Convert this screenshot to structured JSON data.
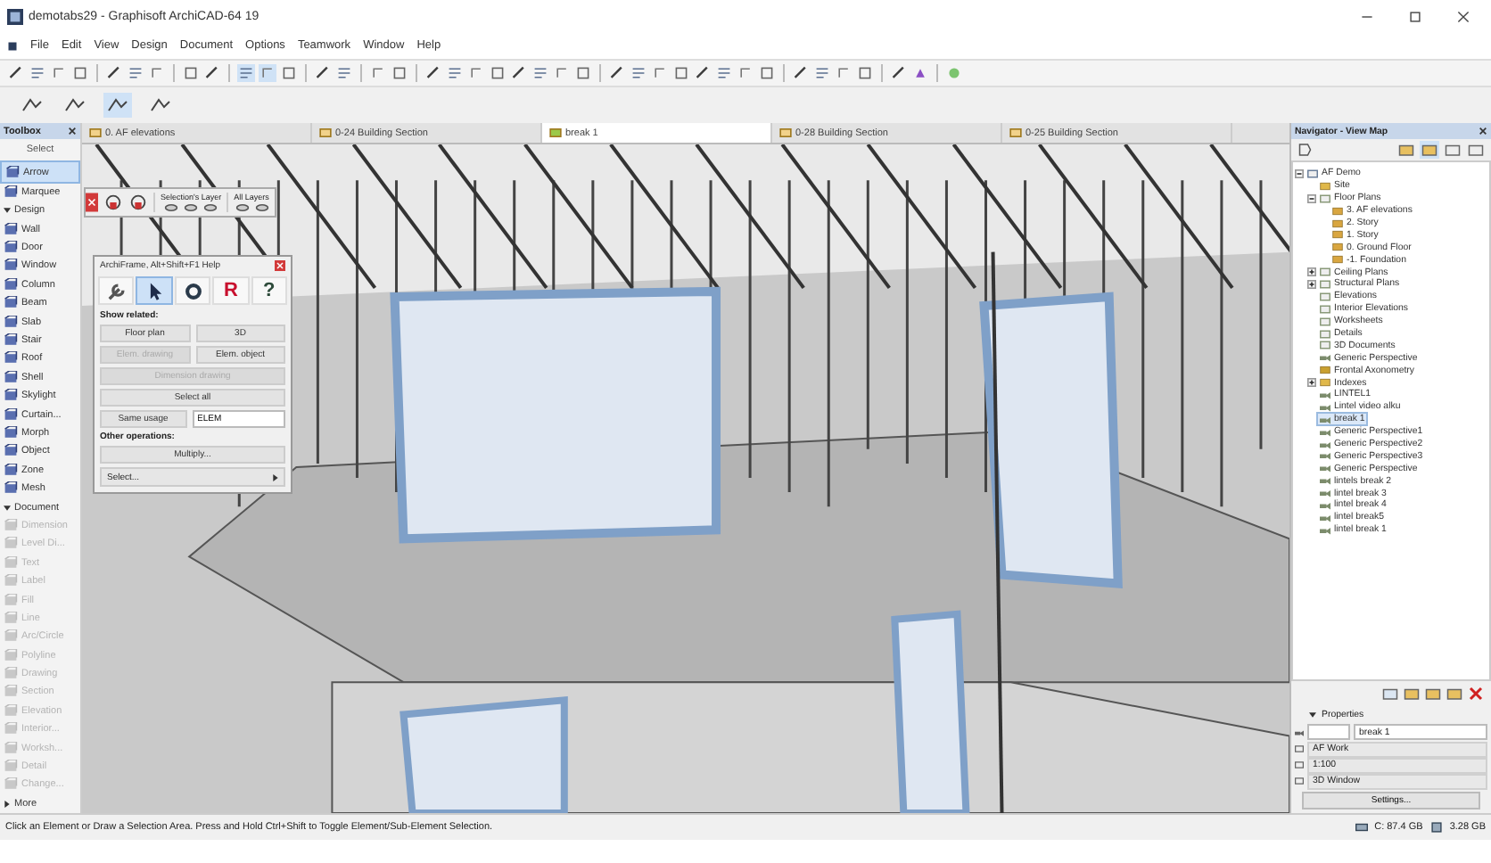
{
  "window": {
    "title": "demotabs29 - Graphisoft ArchiCAD-64 19"
  },
  "menu": [
    "File",
    "Edit",
    "View",
    "Design",
    "Document",
    "Options",
    "Teamwork",
    "Window",
    "Help"
  ],
  "tabs": [
    {
      "label": "0. AF elevations",
      "selected": false
    },
    {
      "label": "0-24 Building Section",
      "selected": false
    },
    {
      "label": "break 1",
      "selected": true
    },
    {
      "label": "0-28 Building Section",
      "selected": false
    },
    {
      "label": "0-25 Building Section",
      "selected": false
    }
  ],
  "toolbox": {
    "title": "Toolbox",
    "items": [
      {
        "kind": "header",
        "label": "Select"
      },
      {
        "kind": "tool",
        "label": "Arrow",
        "selected": true,
        "disabled": false
      },
      {
        "kind": "tool",
        "label": "Marquee",
        "selected": false,
        "disabled": false
      },
      {
        "kind": "section",
        "label": "Design",
        "expanded": true
      },
      {
        "kind": "tool",
        "label": "Wall",
        "selected": false,
        "disabled": false
      },
      {
        "kind": "tool",
        "label": "Door",
        "selected": false,
        "disabled": false
      },
      {
        "kind": "tool",
        "label": "Window",
        "selected": false,
        "disabled": false
      },
      {
        "kind": "tool",
        "label": "Column",
        "selected": false,
        "disabled": false
      },
      {
        "kind": "tool",
        "label": "Beam",
        "selected": false,
        "disabled": false
      },
      {
        "kind": "tool",
        "label": "Slab",
        "selected": false,
        "disabled": false
      },
      {
        "kind": "tool",
        "label": "Stair",
        "selected": false,
        "disabled": false
      },
      {
        "kind": "tool",
        "label": "Roof",
        "selected": false,
        "disabled": false
      },
      {
        "kind": "tool",
        "label": "Shell",
        "selected": false,
        "disabled": false
      },
      {
        "kind": "tool",
        "label": "Skylight",
        "selected": false,
        "disabled": false
      },
      {
        "kind": "tool",
        "label": "Curtain...",
        "selected": false,
        "disabled": false
      },
      {
        "kind": "tool",
        "label": "Morph",
        "selected": false,
        "disabled": false
      },
      {
        "kind": "tool",
        "label": "Object",
        "selected": false,
        "disabled": false
      },
      {
        "kind": "tool",
        "label": "Zone",
        "selected": false,
        "disabled": false
      },
      {
        "kind": "tool",
        "label": "Mesh",
        "selected": false,
        "disabled": false
      },
      {
        "kind": "section",
        "label": "Document",
        "expanded": true
      },
      {
        "kind": "tool",
        "label": "Dimension",
        "selected": false,
        "disabled": true
      },
      {
        "kind": "tool",
        "label": "Level Di...",
        "selected": false,
        "disabled": true
      },
      {
        "kind": "tool",
        "label": "Text",
        "selected": false,
        "disabled": true
      },
      {
        "kind": "tool",
        "label": "Label",
        "selected": false,
        "disabled": true
      },
      {
        "kind": "tool",
        "label": "Fill",
        "selected": false,
        "disabled": true
      },
      {
        "kind": "tool",
        "label": "Line",
        "selected": false,
        "disabled": true
      },
      {
        "kind": "tool",
        "label": "Arc/Circle",
        "selected": false,
        "disabled": true
      },
      {
        "kind": "tool",
        "label": "Polyline",
        "selected": false,
        "disabled": true
      },
      {
        "kind": "tool",
        "label": "Drawing",
        "selected": false,
        "disabled": true
      },
      {
        "kind": "tool",
        "label": "Section",
        "selected": false,
        "disabled": true
      },
      {
        "kind": "tool",
        "label": "Elevation",
        "selected": false,
        "disabled": true
      },
      {
        "kind": "tool",
        "label": "Interior...",
        "selected": false,
        "disabled": true
      },
      {
        "kind": "tool",
        "label": "Worksh...",
        "selected": false,
        "disabled": true
      },
      {
        "kind": "tool",
        "label": "Detail",
        "selected": false,
        "disabled": true
      },
      {
        "kind": "tool",
        "label": "Change...",
        "selected": false,
        "disabled": true
      },
      {
        "kind": "section",
        "label": "More",
        "expanded": false
      }
    ]
  },
  "layer_palette": {
    "layer_label": "Selection's Layer",
    "all_label": "All Layers"
  },
  "archiframe": {
    "title": "ArchiFrame, Alt+Shift+F1 Help",
    "tools": [
      {
        "kind": "wrench",
        "selected": false
      },
      {
        "kind": "arrow",
        "selected": true
      },
      {
        "kind": "ring",
        "selected": false
      },
      {
        "kind": "letter",
        "glyph": "R",
        "selected": false
      },
      {
        "kind": "help",
        "glyph": "?",
        "selected": false
      }
    ],
    "show_related_label": "Show related:",
    "rows": [
      [
        {
          "label": "Floor plan",
          "disabled": false
        },
        {
          "label": "3D",
          "disabled": false
        }
      ],
      [
        {
          "label": "Elem. drawing",
          "disabled": true
        },
        {
          "label": "Elem. object",
          "disabled": false
        }
      ],
      [
        {
          "label": "Dimension drawing",
          "disabled": true
        }
      ],
      [
        {
          "label": "Select all",
          "disabled": false
        }
      ]
    ],
    "same_usage": {
      "label": "Same usage",
      "value": "ELEM"
    },
    "other_label": "Other operations:",
    "multiply": "Multiply...",
    "select": {
      "value": "Select..."
    }
  },
  "navigator": {
    "title": "Navigator - View Map",
    "tree": [
      {
        "label": "AF Demo",
        "kind": "project",
        "selected": false,
        "expanded": true,
        "children": [
          {
            "label": "Site",
            "kind": "folder",
            "selected": false
          },
          {
            "label": "Floor Plans",
            "kind": "plan",
            "selected": false,
            "expanded": true,
            "children": [
              {
                "label": "3. AF elevations",
                "kind": "story",
                "selected": false
              },
              {
                "label": "2. Story",
                "kind": "story",
                "selected": false
              },
              {
                "label": "1. Story",
                "kind": "story",
                "selected": false
              },
              {
                "label": "0. Ground Floor",
                "kind": "story",
                "selected": false
              },
              {
                "label": "-1. Foundation",
                "kind": "story",
                "selected": false
              }
            ]
          },
          {
            "label": "Ceiling Plans",
            "kind": "plan",
            "selected": false,
            "expanded": false
          },
          {
            "label": "Structural Plans",
            "kind": "plan",
            "selected": false,
            "expanded": false
          },
          {
            "label": "Elevations",
            "kind": "plan",
            "selected": false
          },
          {
            "label": "Interior Elevations",
            "kind": "plan",
            "selected": false
          },
          {
            "label": "Worksheets",
            "kind": "plan",
            "selected": false
          },
          {
            "label": "Details",
            "kind": "plan",
            "selected": false
          },
          {
            "label": "3D Documents",
            "kind": "plan",
            "selected": false
          },
          {
            "label": "Generic Perspective",
            "kind": "camera",
            "selected": false
          },
          {
            "label": "Frontal Axonometry",
            "kind": "axon",
            "selected": false
          },
          {
            "label": "Indexes",
            "kind": "folder",
            "selected": false,
            "expanded": false
          },
          {
            "label": "LINTEL1",
            "kind": "camera",
            "selected": false
          },
          {
            "label": "Lintel video alku",
            "kind": "camera",
            "selected": false
          },
          {
            "label": "break 1",
            "kind": "camera",
            "selected": true
          },
          {
            "label": "Generic Perspective1",
            "kind": "camera",
            "selected": false
          },
          {
            "label": "Generic Perspective2",
            "kind": "camera",
            "selected": false
          },
          {
            "label": "Generic Perspective3",
            "kind": "camera",
            "selected": false
          },
          {
            "label": "Generic Perspective",
            "kind": "camera",
            "selected": false
          },
          {
            "label": "lintels break 2",
            "kind": "camera",
            "selected": false
          },
          {
            "label": "lintel break 3",
            "kind": "camera",
            "selected": false
          },
          {
            "label": "lintel break 4",
            "kind": "camera",
            "selected": false
          },
          {
            "label": "lintel break5",
            "kind": "camera",
            "selected": false
          },
          {
            "label": "lintel break 1",
            "kind": "camera",
            "selected": false
          }
        ]
      }
    ],
    "properties": {
      "label": "Properties",
      "expanded": true,
      "name_value": "break 1",
      "rows": [
        "AF Work",
        "1:100",
        "3D Window"
      ],
      "settings": "Settings..."
    }
  },
  "status": {
    "message": "Click an Element or Draw a Selection Area. Press and Hold Ctrl+Shift to Toggle Element/Sub-Element Selection.",
    "disk": "C: 87.4 GB",
    "memory": "3.28 GB"
  }
}
